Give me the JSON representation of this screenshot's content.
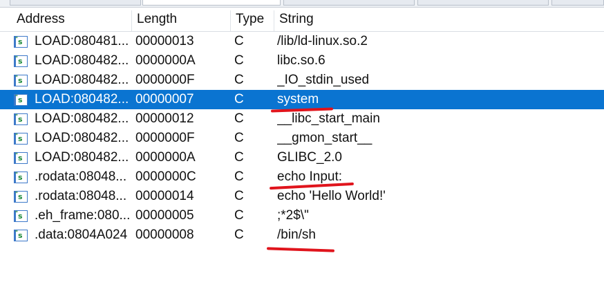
{
  "columns": {
    "address": "Address",
    "length": "Length",
    "type": "Type",
    "string": "String"
  },
  "rows": [
    {
      "address": "LOAD:080481...",
      "length": "00000013",
      "type": "C",
      "string": "/lib/ld-linux.so.2",
      "selected": false
    },
    {
      "address": "LOAD:080482...",
      "length": "0000000A",
      "type": "C",
      "string": "libc.so.6",
      "selected": false
    },
    {
      "address": "LOAD:080482...",
      "length": "0000000F",
      "type": "C",
      "string": "_IO_stdin_used",
      "selected": false
    },
    {
      "address": "LOAD:080482...",
      "length": "00000007",
      "type": "C",
      "string": "system",
      "selected": true
    },
    {
      "address": "LOAD:080482...",
      "length": "00000012",
      "type": "C",
      "string": "__libc_start_main",
      "selected": false
    },
    {
      "address": "LOAD:080482...",
      "length": "0000000F",
      "type": "C",
      "string": "__gmon_start__",
      "selected": false
    },
    {
      "address": "LOAD:080482...",
      "length": "0000000A",
      "type": "C",
      "string": "GLIBC_2.0",
      "selected": false
    },
    {
      "address": ".rodata:08048...",
      "length": "0000000C",
      "type": "C",
      "string": "echo Input:",
      "selected": false
    },
    {
      "address": ".rodata:08048...",
      "length": "00000014",
      "type": "C",
      "string": "echo 'Hello World!'",
      "selected": false
    },
    {
      "address": ".eh_frame:080...",
      "length": "00000005",
      "type": "C",
      "string": ";*2$\\\"",
      "selected": false
    },
    {
      "address": ".data:0804A024",
      "length": "00000008",
      "type": "C",
      "string": "/bin/sh",
      "selected": false
    }
  ],
  "row_icon": "string-s-icon",
  "colors": {
    "selection": "#0a74d1",
    "annotation": "#e0141c",
    "icon_border": "#3d79c9",
    "icon_glyph": "#1d8a3a"
  }
}
